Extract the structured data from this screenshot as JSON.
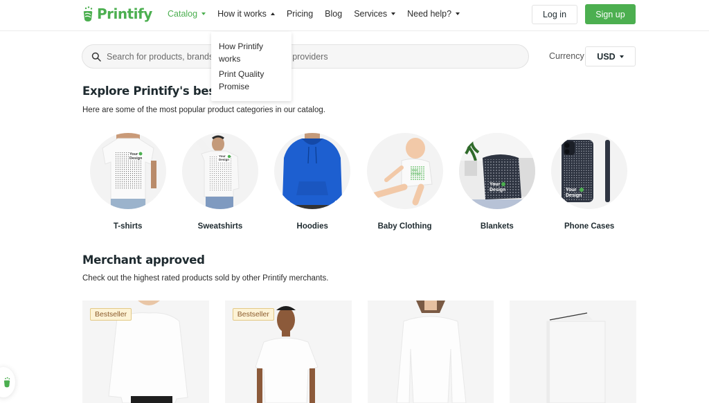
{
  "brand": {
    "name": "Printify",
    "accent": "#4caf50"
  },
  "nav": {
    "items": [
      {
        "label": "Catalog",
        "caret": "down",
        "active": true
      },
      {
        "label": "How it works",
        "caret": "up",
        "active": false
      },
      {
        "label": "Pricing",
        "caret": null,
        "active": false
      },
      {
        "label": "Blog",
        "caret": null,
        "active": false
      },
      {
        "label": "Services",
        "caret": "down",
        "active": false
      },
      {
        "label": "Need help?",
        "caret": "down",
        "active": false
      }
    ],
    "login_label": "Log in",
    "signup_label": "Sign up"
  },
  "dropdown": {
    "items": [
      {
        "label": "How Printify works"
      },
      {
        "label": "Print Quality Promise"
      }
    ]
  },
  "search": {
    "placeholder": "Search for products, brands, categories, or print providers",
    "value": ""
  },
  "currency": {
    "label": "Currency",
    "value": "USD"
  },
  "explore": {
    "title": "Explore Printify's best",
    "subtitle": "Here are some of the most popular product categories in our catalog.",
    "categories": [
      {
        "label": "T-shirts",
        "image": "white t-shirt with Your Design print"
      },
      {
        "label": "Sweatshirts",
        "image": "white sweatshirt with Your Design print"
      },
      {
        "label": "Hoodies",
        "image": "blue hoodie"
      },
      {
        "label": "Baby Clothing",
        "image": "baby in white bodysuit"
      },
      {
        "label": "Blankets",
        "image": "dark patterned blanket on sofa"
      },
      {
        "label": "Phone Cases",
        "image": "dark patterned phone case"
      }
    ]
  },
  "merchant": {
    "title": "Merchant approved",
    "subtitle": "Check out the highest rated products sold by other Printify merchants.",
    "products": [
      {
        "badge": "Bestseller",
        "image": "white sweatshirt on model"
      },
      {
        "badge": "Bestseller",
        "image": "white t-shirt on model"
      },
      {
        "badge": null,
        "image": "white long sleeve on model"
      },
      {
        "badge": null,
        "image": "white hardcover journal"
      }
    ]
  }
}
